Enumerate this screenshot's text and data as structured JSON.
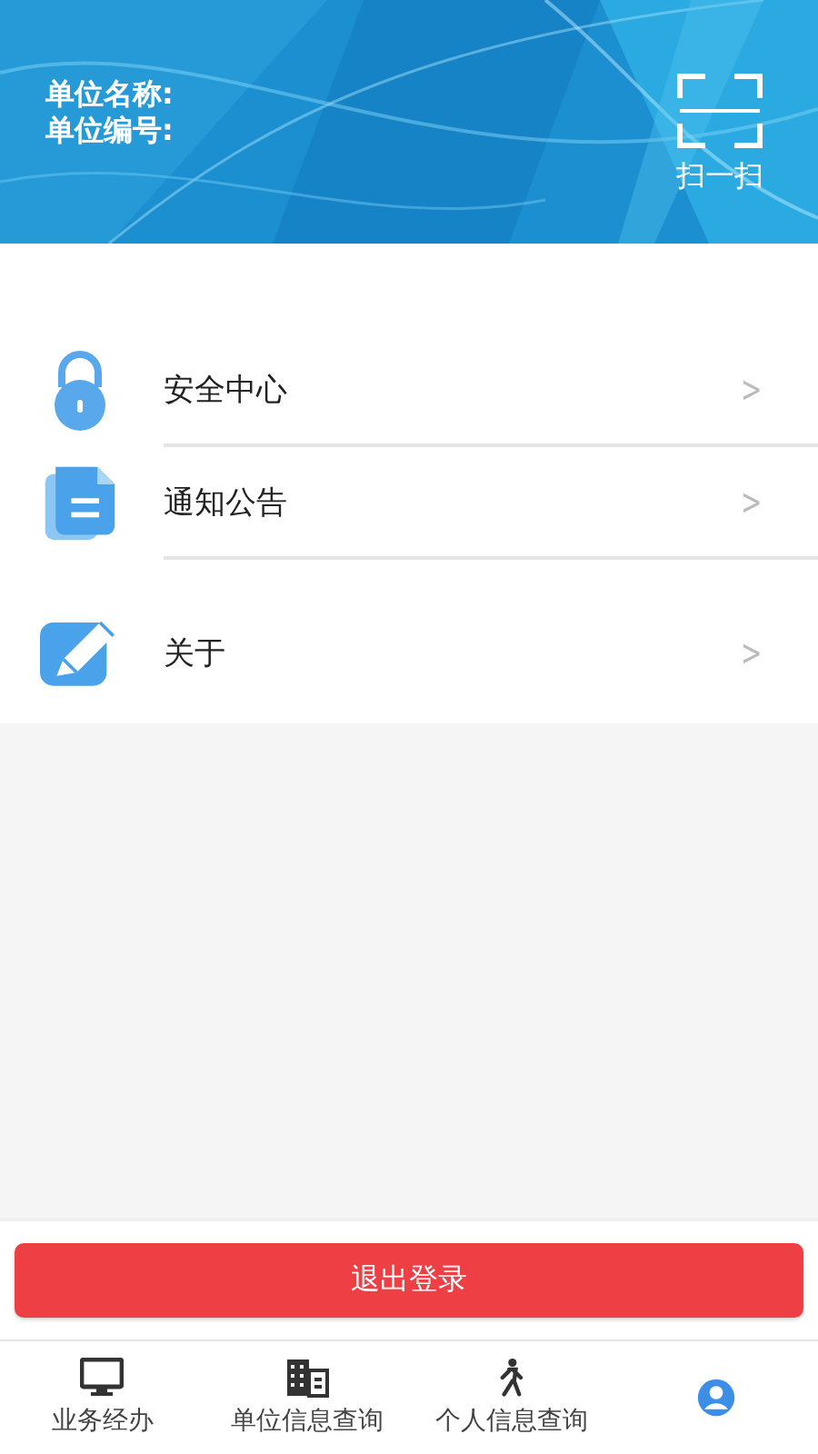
{
  "header": {
    "unit_name_label": "单位名称:",
    "unit_code_label": "单位编号:",
    "scan_label": "扫一扫"
  },
  "menu": [
    {
      "kind": "lock",
      "label": "安全中心",
      "chevron": ">"
    },
    {
      "kind": "docs",
      "label": "通知公告",
      "chevron": ">"
    },
    {
      "kind": "pencil",
      "label": "关于",
      "chevron": ">"
    }
  ],
  "logout_button": "退出登录",
  "tabs": [
    {
      "kind": "monitor",
      "label": "业务经办",
      "selected": false
    },
    {
      "kind": "building",
      "label": "单位信息查询",
      "selected": false
    },
    {
      "kind": "walker",
      "label": "个人信息查询",
      "selected": false
    },
    {
      "kind": "person",
      "selected": true
    }
  ]
}
